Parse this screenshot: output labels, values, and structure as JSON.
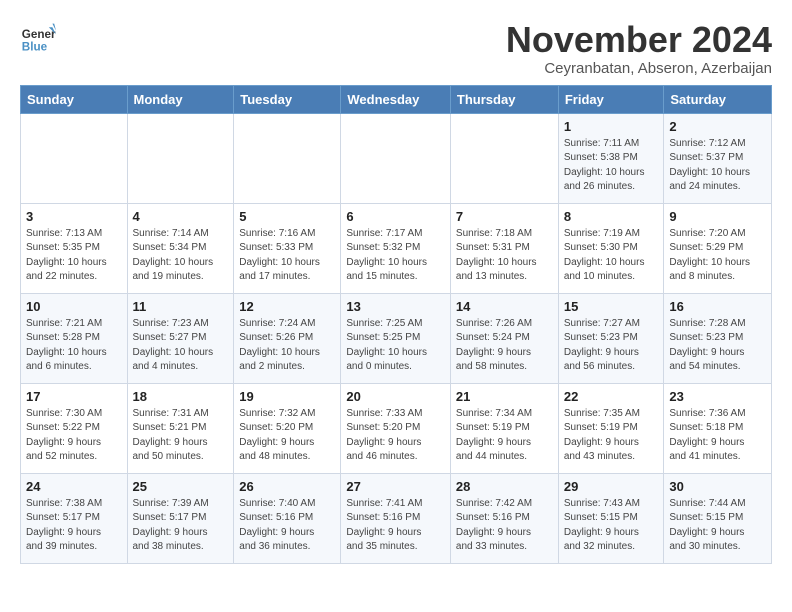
{
  "header": {
    "logo_line1": "General",
    "logo_line2": "Blue",
    "month_title": "November 2024",
    "subtitle": "Ceyranbatan, Abseron, Azerbaijan"
  },
  "weekdays": [
    "Sunday",
    "Monday",
    "Tuesday",
    "Wednesday",
    "Thursday",
    "Friday",
    "Saturday"
  ],
  "weeks": [
    [
      {
        "day": "",
        "info": ""
      },
      {
        "day": "",
        "info": ""
      },
      {
        "day": "",
        "info": ""
      },
      {
        "day": "",
        "info": ""
      },
      {
        "day": "",
        "info": ""
      },
      {
        "day": "1",
        "info": "Sunrise: 7:11 AM\nSunset: 5:38 PM\nDaylight: 10 hours\nand 26 minutes."
      },
      {
        "day": "2",
        "info": "Sunrise: 7:12 AM\nSunset: 5:37 PM\nDaylight: 10 hours\nand 24 minutes."
      }
    ],
    [
      {
        "day": "3",
        "info": "Sunrise: 7:13 AM\nSunset: 5:35 PM\nDaylight: 10 hours\nand 22 minutes."
      },
      {
        "day": "4",
        "info": "Sunrise: 7:14 AM\nSunset: 5:34 PM\nDaylight: 10 hours\nand 19 minutes."
      },
      {
        "day": "5",
        "info": "Sunrise: 7:16 AM\nSunset: 5:33 PM\nDaylight: 10 hours\nand 17 minutes."
      },
      {
        "day": "6",
        "info": "Sunrise: 7:17 AM\nSunset: 5:32 PM\nDaylight: 10 hours\nand 15 minutes."
      },
      {
        "day": "7",
        "info": "Sunrise: 7:18 AM\nSunset: 5:31 PM\nDaylight: 10 hours\nand 13 minutes."
      },
      {
        "day": "8",
        "info": "Sunrise: 7:19 AM\nSunset: 5:30 PM\nDaylight: 10 hours\nand 10 minutes."
      },
      {
        "day": "9",
        "info": "Sunrise: 7:20 AM\nSunset: 5:29 PM\nDaylight: 10 hours\nand 8 minutes."
      }
    ],
    [
      {
        "day": "10",
        "info": "Sunrise: 7:21 AM\nSunset: 5:28 PM\nDaylight: 10 hours\nand 6 minutes."
      },
      {
        "day": "11",
        "info": "Sunrise: 7:23 AM\nSunset: 5:27 PM\nDaylight: 10 hours\nand 4 minutes."
      },
      {
        "day": "12",
        "info": "Sunrise: 7:24 AM\nSunset: 5:26 PM\nDaylight: 10 hours\nand 2 minutes."
      },
      {
        "day": "13",
        "info": "Sunrise: 7:25 AM\nSunset: 5:25 PM\nDaylight: 10 hours\nand 0 minutes."
      },
      {
        "day": "14",
        "info": "Sunrise: 7:26 AM\nSunset: 5:24 PM\nDaylight: 9 hours\nand 58 minutes."
      },
      {
        "day": "15",
        "info": "Sunrise: 7:27 AM\nSunset: 5:23 PM\nDaylight: 9 hours\nand 56 minutes."
      },
      {
        "day": "16",
        "info": "Sunrise: 7:28 AM\nSunset: 5:23 PM\nDaylight: 9 hours\nand 54 minutes."
      }
    ],
    [
      {
        "day": "17",
        "info": "Sunrise: 7:30 AM\nSunset: 5:22 PM\nDaylight: 9 hours\nand 52 minutes."
      },
      {
        "day": "18",
        "info": "Sunrise: 7:31 AM\nSunset: 5:21 PM\nDaylight: 9 hours\nand 50 minutes."
      },
      {
        "day": "19",
        "info": "Sunrise: 7:32 AM\nSunset: 5:20 PM\nDaylight: 9 hours\nand 48 minutes."
      },
      {
        "day": "20",
        "info": "Sunrise: 7:33 AM\nSunset: 5:20 PM\nDaylight: 9 hours\nand 46 minutes."
      },
      {
        "day": "21",
        "info": "Sunrise: 7:34 AM\nSunset: 5:19 PM\nDaylight: 9 hours\nand 44 minutes."
      },
      {
        "day": "22",
        "info": "Sunrise: 7:35 AM\nSunset: 5:19 PM\nDaylight: 9 hours\nand 43 minutes."
      },
      {
        "day": "23",
        "info": "Sunrise: 7:36 AM\nSunset: 5:18 PM\nDaylight: 9 hours\nand 41 minutes."
      }
    ],
    [
      {
        "day": "24",
        "info": "Sunrise: 7:38 AM\nSunset: 5:17 PM\nDaylight: 9 hours\nand 39 minutes."
      },
      {
        "day": "25",
        "info": "Sunrise: 7:39 AM\nSunset: 5:17 PM\nDaylight: 9 hours\nand 38 minutes."
      },
      {
        "day": "26",
        "info": "Sunrise: 7:40 AM\nSunset: 5:16 PM\nDaylight: 9 hours\nand 36 minutes."
      },
      {
        "day": "27",
        "info": "Sunrise: 7:41 AM\nSunset: 5:16 PM\nDaylight: 9 hours\nand 35 minutes."
      },
      {
        "day": "28",
        "info": "Sunrise: 7:42 AM\nSunset: 5:16 PM\nDaylight: 9 hours\nand 33 minutes."
      },
      {
        "day": "29",
        "info": "Sunrise: 7:43 AM\nSunset: 5:15 PM\nDaylight: 9 hours\nand 32 minutes."
      },
      {
        "day": "30",
        "info": "Sunrise: 7:44 AM\nSunset: 5:15 PM\nDaylight: 9 hours\nand 30 minutes."
      }
    ]
  ]
}
